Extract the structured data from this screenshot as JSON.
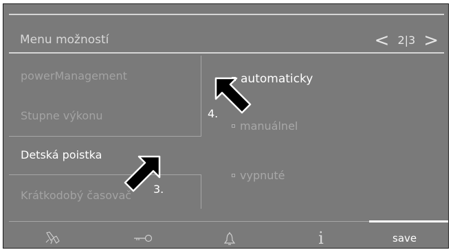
{
  "menu": {
    "title": "Menu možností",
    "prev_glyph": "<",
    "next_glyph": ">",
    "page_indicator": "2|3"
  },
  "left_items": [
    {
      "label": "powerManagement",
      "active": false
    },
    {
      "label": "Stupne výkonu",
      "active": false
    },
    {
      "label": "Detská poistka",
      "active": true
    },
    {
      "label": "Krátkodobý časovač",
      "active": false
    }
  ],
  "options": [
    {
      "label": "automaticky",
      "selected": true
    },
    {
      "label": "manuálnel",
      "selected": false
    },
    {
      "label": "vypnuté",
      "selected": false
    }
  ],
  "step_labels": {
    "step3": "3.",
    "step4": "4."
  },
  "bottom_bar": {
    "icons": [
      "touch-lock-icon",
      "key-icon",
      "bell-icon",
      "info-icon"
    ],
    "info_glyph": "i",
    "save_label": "save"
  },
  "colors": {
    "panel_background": "#7a7a7a",
    "active_text": "#ffffff",
    "inactive_text": "#a3a3a3",
    "pointer_fill": "#000000"
  }
}
